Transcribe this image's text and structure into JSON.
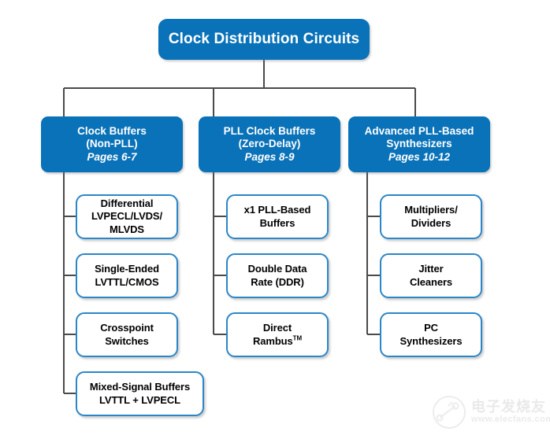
{
  "diagram": {
    "title": "Clock Distribution Circuits",
    "root": {
      "label": "Clock Distribution Circuits"
    },
    "branches": [
      {
        "id": "clock-buffers",
        "line1": "Clock Buffers",
        "line2": "(Non-PLL)",
        "pages": "Pages 6-7",
        "leaves": [
          {
            "line1": "Differential",
            "line2": "LVPECL/LVDS/",
            "line3": "MLVDS"
          },
          {
            "line1": "Single-Ended",
            "line2": "LVTTL/CMOS"
          },
          {
            "line1": "Crosspoint",
            "line2": "Switches"
          },
          {
            "line1": "Mixed-Signal Buffers",
            "line2": "LVTTL + LVPECL"
          }
        ]
      },
      {
        "id": "pll-clock-buffers",
        "line1": "PLL Clock Buffers",
        "line2": "(Zero-Delay)",
        "pages": "Pages 8-9",
        "leaves": [
          {
            "line1": "x1 PLL-Based",
            "line2": "Buffers"
          },
          {
            "line1": "Double Data",
            "line2": "Rate (DDR)"
          },
          {
            "line1": "Direct",
            "line2": "Rambus",
            "sup": "TM"
          }
        ]
      },
      {
        "id": "advanced-pll-synthesizers",
        "line1": "Advanced PLL-Based",
        "line2": "Synthesizers",
        "pages": "Pages 10-12",
        "leaves": [
          {
            "line1": "Multipliers/",
            "line2": "Dividers"
          },
          {
            "line1": "Jitter",
            "line2": "Cleaners"
          },
          {
            "line1": "PC",
            "line2": "Synthesizers"
          }
        ]
      }
    ]
  },
  "watermark": {
    "chinese": "电子发烧友",
    "url": "www.elecfans.com"
  },
  "colors": {
    "node_blue": "#0a72b8",
    "leaf_border": "#2b86c8",
    "leaf_fill": "#ffffff",
    "connector": "#4a4a4a",
    "text_light": "#ffffff",
    "text_dark": "#000000"
  }
}
